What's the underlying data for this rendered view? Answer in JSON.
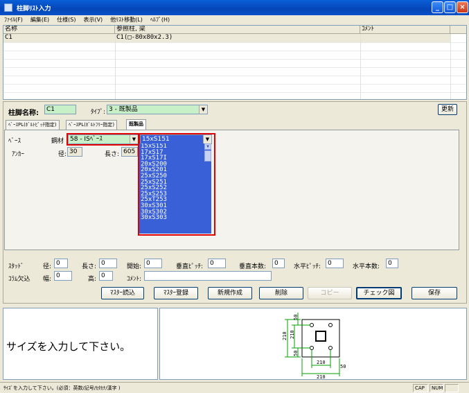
{
  "window": {
    "title": "柱脚ﾘｽﾄ入力"
  },
  "menu": [
    "ﾌｧｲﾙ(F)",
    "編集(E)",
    "仕様(S)",
    "表示(V)",
    "他ﾘｽﾄ移動(L)",
    "ﾍﾙﾌﾟ(H)"
  ],
  "grid": {
    "headers": [
      "名称",
      "参照柱, 梁",
      "ｺﾒﾝﾄ"
    ],
    "rows": [
      {
        "name": "C1",
        "ref": "C1(□-80x80x2.3)",
        "comment": ""
      }
    ]
  },
  "form": {
    "name_label": "柱脚名称:",
    "name_value": "C1",
    "type_label": "ﾀｲﾌﾟ:",
    "type_value": "3 - 既製品",
    "update_label": "更新",
    "tabs": [
      "ﾍﾞｰｽPL(ﾎﾞﾙﾄﾋﾟｯﾁ指定)",
      "ﾍﾞｰｽPL(ﾎﾞﾙﾄﾌﾘｰ指定)",
      "既製品"
    ],
    "base_label": "ﾍﾞｰｽ",
    "steel_label": "鋼材",
    "steel_value": "58 - ISﾍﾞｰｽ",
    "size_value": "15xS151",
    "anchor_label": "ｱﾝｶｰ",
    "diameter_label": "径:",
    "diameter_value": "30",
    "length_label": "長さ:",
    "length_value": "605",
    "size_options": [
      "15xS151",
      "17xS17",
      "17xS17I",
      "20xS200",
      "20xS201",
      "25xS250",
      "25xS251",
      "25xS252",
      "25xS253",
      "25xT253",
      "30xS301",
      "30xS302",
      "30xS303"
    ],
    "stud": {
      "label": "ｽﾀｯﾄﾞ",
      "diameter_label": "径:",
      "diameter_value": "0",
      "length_label": "長さ:",
      "length_value": "0",
      "start_label": "開始:",
      "start_value": "0",
      "vpitch_label": "垂直ﾋﾟｯﾁ:",
      "vpitch_value": "0",
      "vcount_label": "垂直本数:",
      "vcount_value": "0",
      "hpitch_label": "水平ﾋﾟｯﾁ:",
      "hpitch_value": "0",
      "hcount_label": "水平本数:",
      "hcount_value": "0"
    },
    "column_cut": {
      "label": "ｺﾗﾑ欠込",
      "width_label": "幅:",
      "width_value": "0",
      "height_label": "高:",
      "height_value": "0",
      "comment_label": "ｺﾒﾝﾄ:",
      "comment_value": ""
    }
  },
  "buttons": {
    "master_load": "ﾏｽﾀｰ読込",
    "master_register": "ﾏｽﾀｰ登録",
    "new": "新規作成",
    "delete": "削除",
    "copy": "コピー",
    "check": "チェック図",
    "save": "保存"
  },
  "message": "サイズを入力して下さい。",
  "preview": {
    "dim_210_a": "210",
    "dim_210_b": "210",
    "dim_210_c": "210",
    "dim_210_d": "210",
    "dim_50_a": "50",
    "dim_50_b": "50",
    "dim_50_c": "50"
  },
  "status": {
    "text": "ｻｲｽﾞを入力して下さい。(必須：英数/記号/ｶﾀｶﾅ/漢字 )",
    "cap": "CAP",
    "num": "NUM"
  }
}
